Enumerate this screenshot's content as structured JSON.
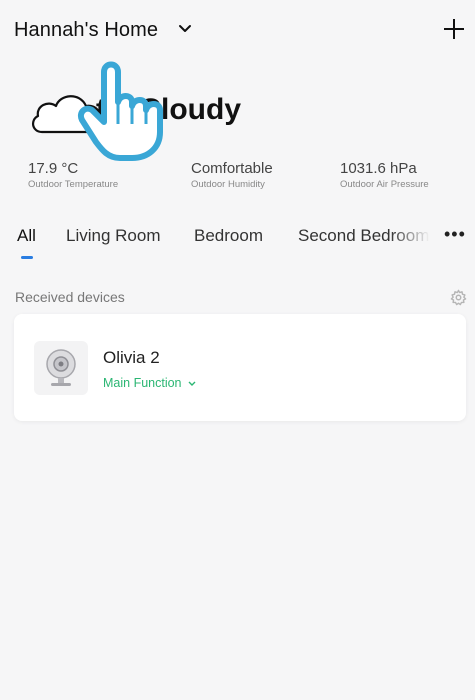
{
  "header": {
    "home_name": "Hannah's Home",
    "add_icon": "plus-icon",
    "dropdown_icon": "chevron-down-icon"
  },
  "weather": {
    "condition": "tly Cloudy",
    "icon": "cloud-icon"
  },
  "stats": [
    {
      "value": "17.9 °C",
      "label": "Outdoor Temperature"
    },
    {
      "value": "Comfortable",
      "label": "Outdoor Humidity"
    },
    {
      "value": "1031.6 hPa",
      "label": "Outdoor Air Pressure"
    }
  ],
  "tabs": {
    "items": [
      "All",
      "Living Room",
      "Bedroom",
      "Second Bedroom"
    ],
    "selected": "All",
    "more_icon": "more-icon"
  },
  "devices_section": {
    "title": "Received devices",
    "settings_icon": "gear-icon"
  },
  "device": {
    "name": "Olivia 2",
    "function": "Main Function",
    "icon": "camera-icon"
  },
  "colors": {
    "accent": "#2a7de1",
    "function_green": "#2bb673",
    "background": "#f6f6f7",
    "hand": "#3aa7d6"
  }
}
